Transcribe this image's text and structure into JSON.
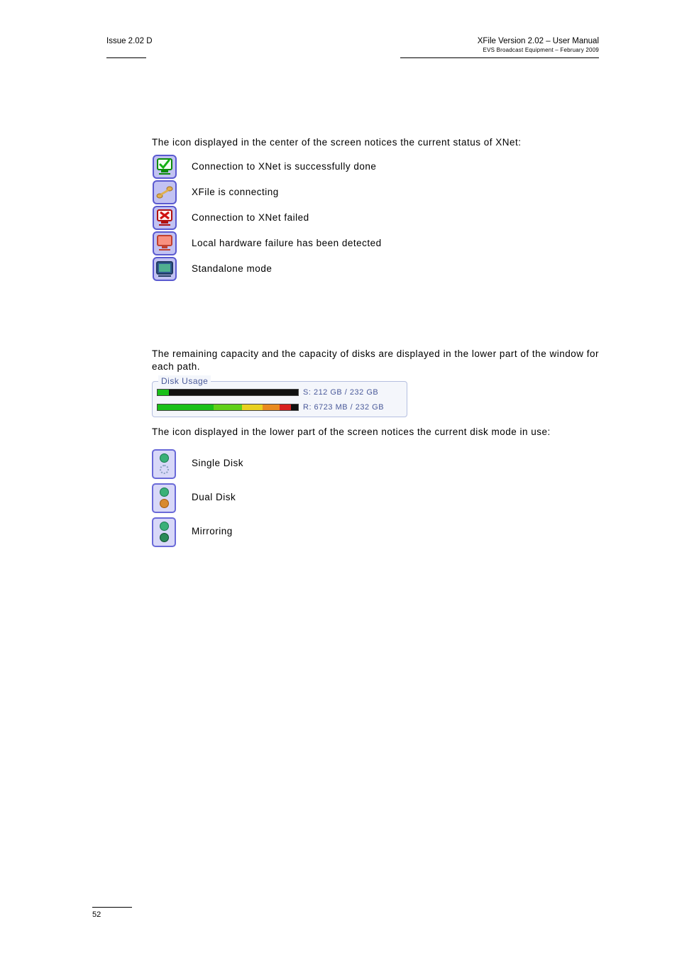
{
  "header": {
    "issue": "Issue 2.02 D",
    "doc_title": "XFile Version 2.02 – User Manual",
    "doc_sub": "EVS Broadcast Equipment – February 2009"
  },
  "intro_status": "The icon displayed in the center of the screen notices the current status of XNet:",
  "status": [
    {
      "icon": "xnet-connected-icon",
      "label": "Connection to XNet is successfully done"
    },
    {
      "icon": "xnet-connecting-icon",
      "label": "XFile is connecting"
    },
    {
      "icon": "xnet-failed-icon",
      "label": "Connection to XNet failed"
    },
    {
      "icon": "hardware-failure-icon",
      "label": "Local hardware failure has been detected"
    },
    {
      "icon": "standalone-icon",
      "label": "Standalone mode"
    }
  ],
  "intro_capacity": "The remaining capacity and the capacity of disks are displayed in the lower part of the window for each path.",
  "disk_usage": {
    "title": "Disk Usage",
    "rows": [
      {
        "text": "S: 212 GB / 232 GB",
        "fill_pct": 8
      },
      {
        "text": "R: 6723 MB / 232 GB",
        "fill_pct": 95
      }
    ]
  },
  "intro_diskmode": "The icon displayed in the lower part of the screen notices the current disk mode in use:",
  "disk_modes": [
    {
      "label": "Single Disk",
      "top": "green",
      "bottom": "dot"
    },
    {
      "label": "Dual Disk",
      "top": "green",
      "bottom": "orange"
    },
    {
      "label": "Mirroring",
      "top": "green",
      "bottom": "green-dark"
    }
  ],
  "page_number": "52"
}
